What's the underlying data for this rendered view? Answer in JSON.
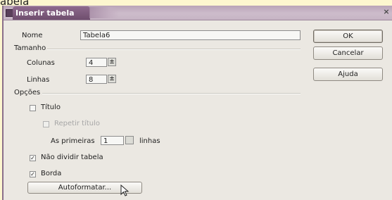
{
  "caption": "abela",
  "window": {
    "title": "Inserir tabela",
    "close": "×"
  },
  "name_section": {
    "label": "Nome",
    "value": "Tabela6"
  },
  "size_section": {
    "header": "Tamanho",
    "columns_label": "Colunas",
    "columns_value": "4",
    "rows_label": "Linhas",
    "rows_value": "8",
    "spin_glyph": "±"
  },
  "options_section": {
    "header": "Opções",
    "title_label": "Título",
    "title_checked": false,
    "repeat_title_label": "Repetir título",
    "repeat_title_checked": false,
    "first_label": "As primeiras",
    "first_value": "1",
    "rows_suffix": "linhas",
    "dont_split_label": "Não dividir tabela",
    "dont_split_checked": true,
    "border_label": "Borda",
    "border_checked": true,
    "check_mark": "✓"
  },
  "autoformat_button": "Autoformatar...",
  "buttons": {
    "ok": "OK",
    "cancel": "Cancelar",
    "help": "Ajuda"
  }
}
